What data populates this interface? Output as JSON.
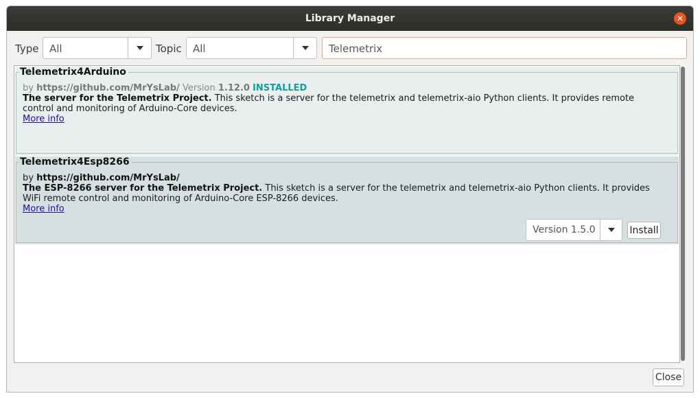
{
  "window": {
    "title": "Library Manager",
    "close_icon": "close-icon"
  },
  "filters": {
    "type_label": "Type",
    "type_value": "All",
    "topic_label": "Topic",
    "topic_value": "All",
    "search_value": "Telemetrix"
  },
  "libraries": [
    {
      "name": "Telemetrix4Arduino",
      "by": "by",
      "author": "https://github.com/MrYsLab/",
      "version_label": "Version",
      "version": "1.12.0",
      "status": "INSTALLED",
      "summary": "The server for the Telemetrix Project.",
      "description": "This sketch is a server for the telemetrix and telemetrix-aio Python clients. It provides remote control and monitoring of Arduino-Core devices.",
      "more_info": "More info"
    },
    {
      "name": "Telemetrix4Esp8266",
      "by": "by",
      "author": "https://github.com/MrYsLab/",
      "summary": "The ESP-8266 server for the Telemetrix Project.",
      "description": "This sketch is a server for the telemetrix and telemetrix-aio Python clients. It provides WiFi remote control and monitoring of Arduino-Core ESP-8266 devices.",
      "more_info": "More info",
      "selected_version": "Version 1.5.0",
      "install_label": "Install"
    }
  ],
  "footer": {
    "close_label": "Close"
  },
  "colors": {
    "accent": "#e95420",
    "installed": "#139d9d",
    "link": "#1a0dab"
  }
}
